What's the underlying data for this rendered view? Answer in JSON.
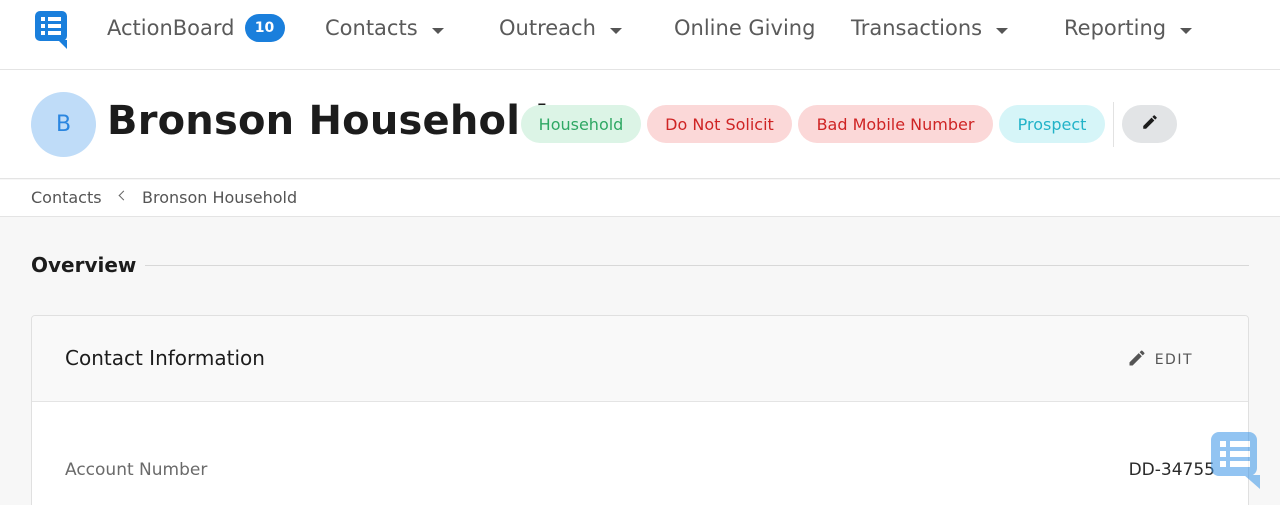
{
  "nav": {
    "logo_icon": "chat-board-logo-icon",
    "items": [
      {
        "label": "ActionBoard",
        "badge": "10"
      },
      {
        "label": "Contacts"
      },
      {
        "label": "Outreach"
      },
      {
        "label": "Online Giving"
      },
      {
        "label": "Transactions"
      },
      {
        "label": "Reporting"
      }
    ]
  },
  "header": {
    "avatar_letter": "B",
    "title": "Bronson Household",
    "tags": [
      {
        "label": "Household",
        "color": "#2fa864"
      },
      {
        "label": "Do Not Solicit",
        "color": "#cf2424"
      },
      {
        "label": "Bad Mobile Number",
        "color": "#cf2424"
      },
      {
        "label": "Prospect",
        "color": "#22b3c8"
      }
    ],
    "edit_icon": "pencil-icon"
  },
  "breadcrumb": {
    "items": [
      "Contacts",
      "Bronson Household"
    ]
  },
  "overview": {
    "title": "Overview",
    "card": {
      "title": "Contact Information",
      "edit_label": "EDIT",
      "fields": [
        {
          "label": "Account Number",
          "value": "DD-34755"
        }
      ]
    }
  },
  "colors": {
    "accent": "#1a7fdc",
    "avatar_bg": "#bfdcf8"
  }
}
